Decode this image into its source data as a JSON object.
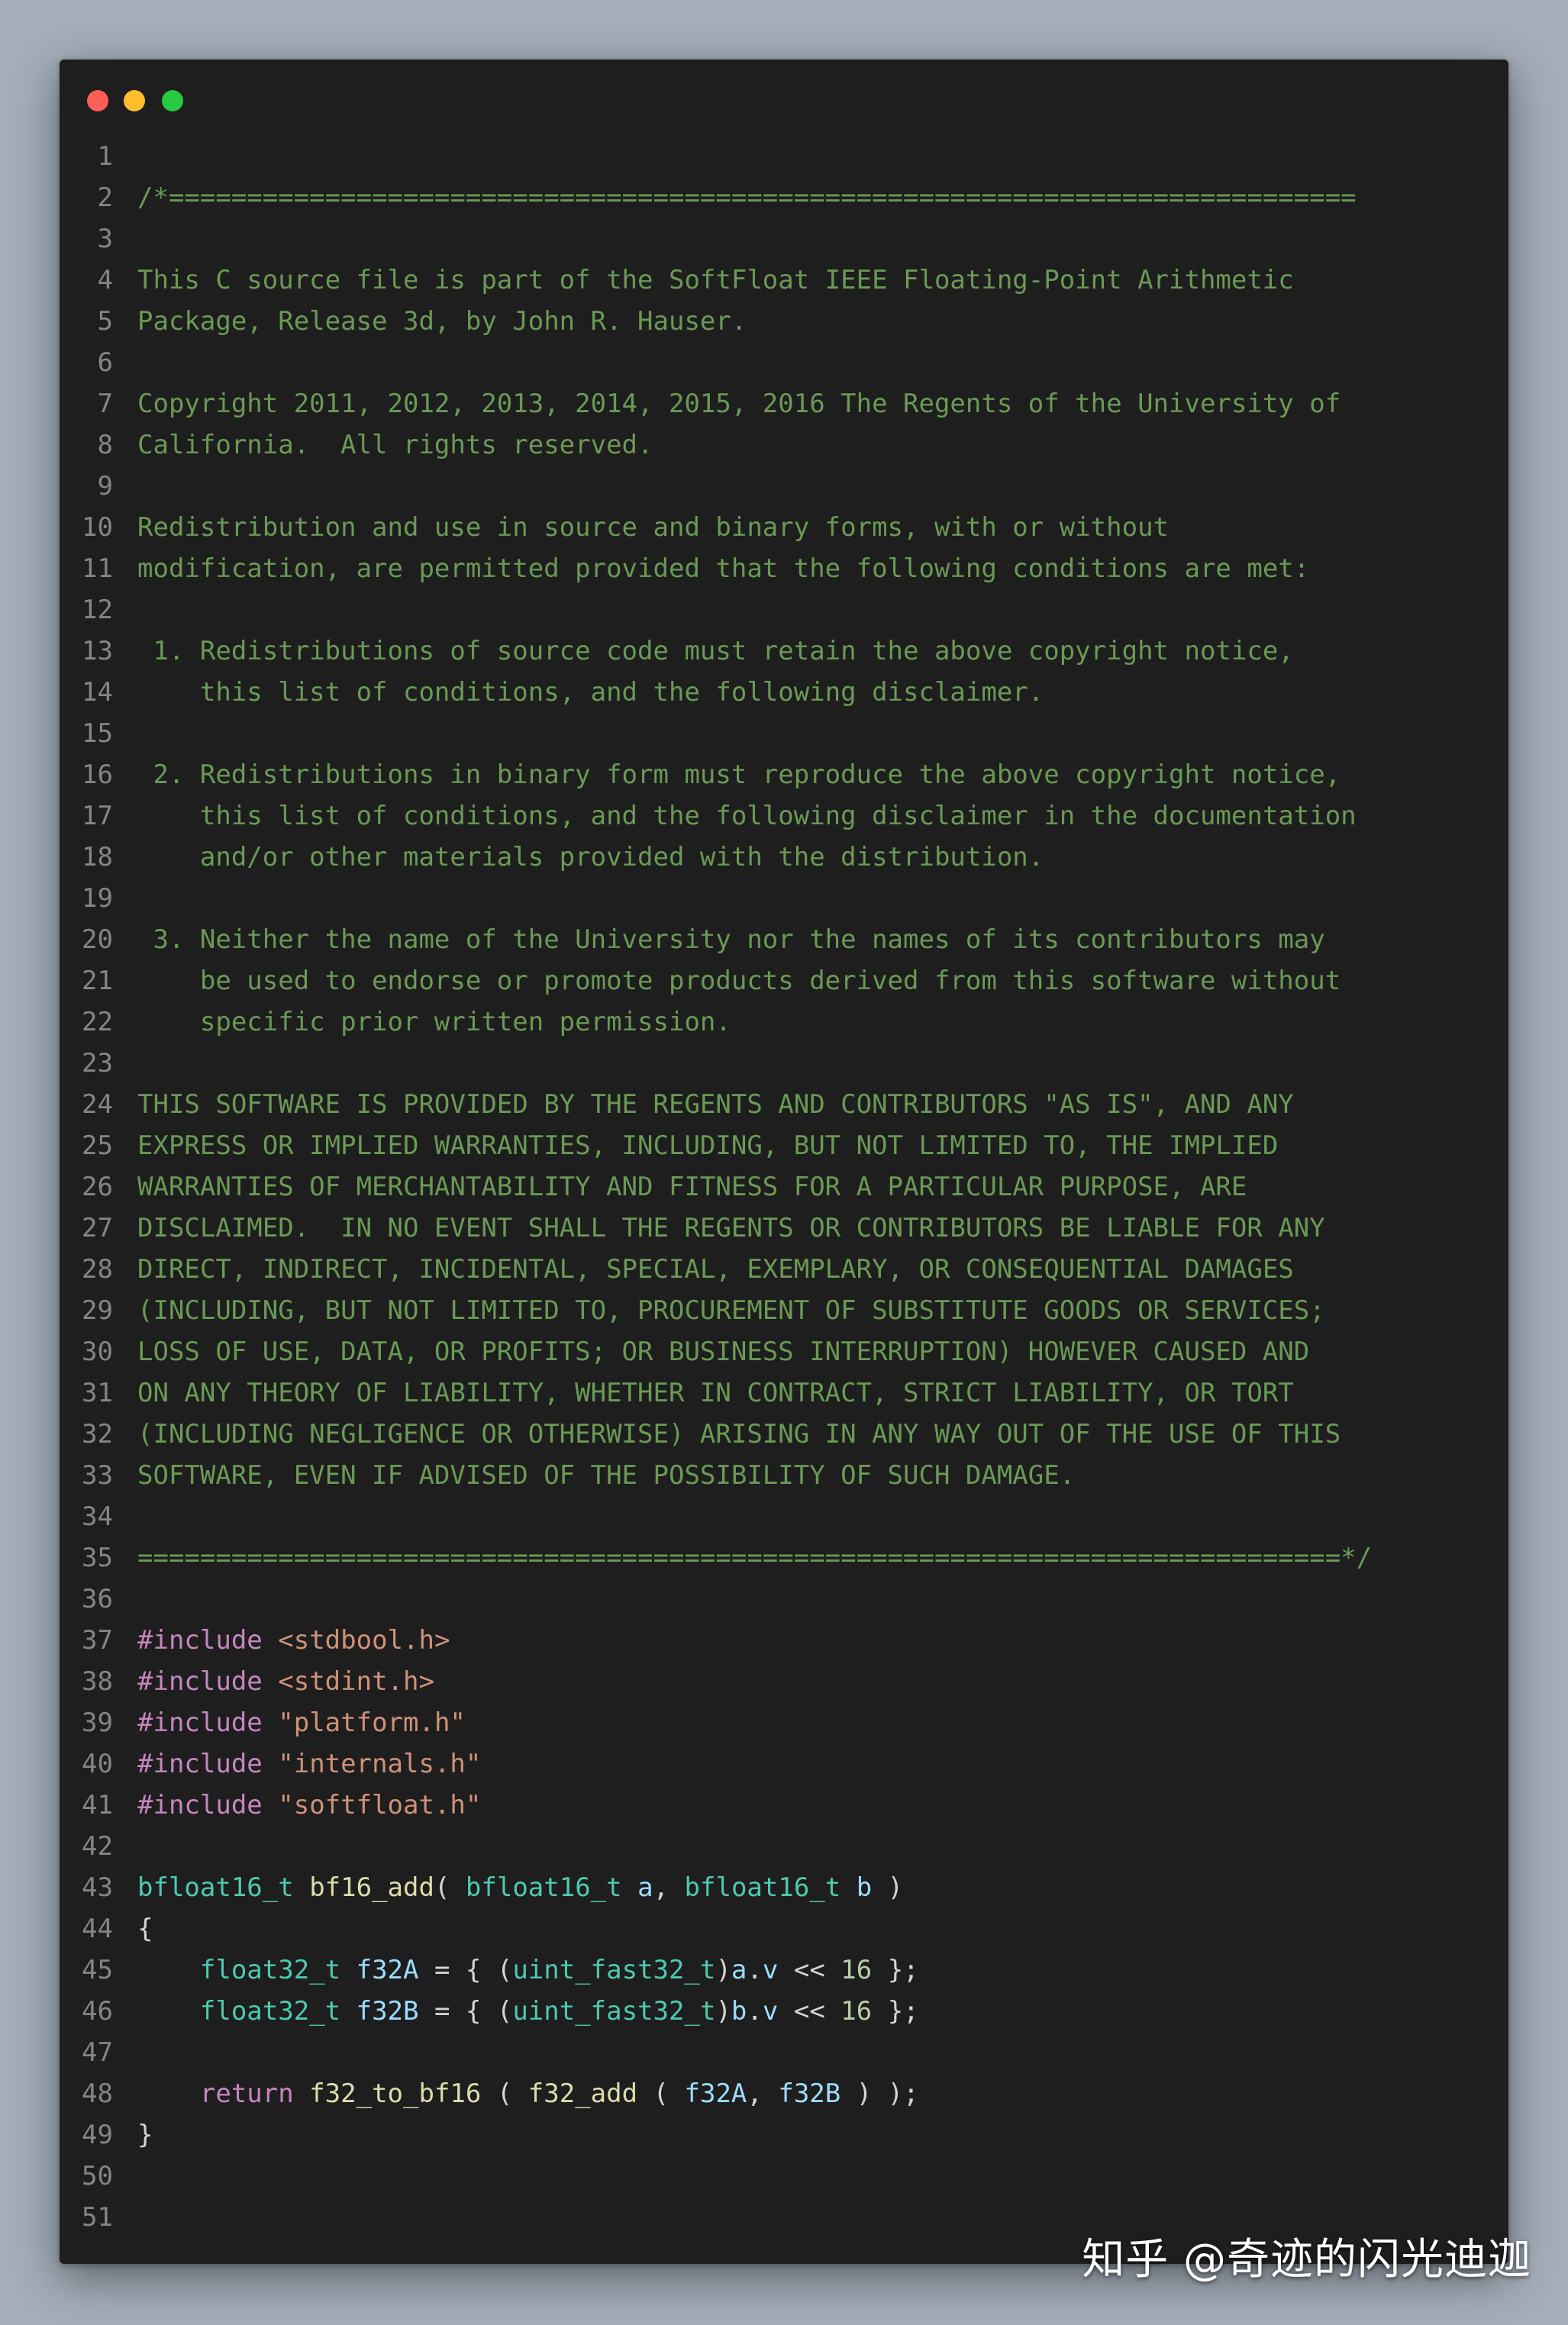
{
  "window": {
    "traffic_lights": [
      "close",
      "minimize",
      "maximize"
    ]
  },
  "editor": {
    "lines": [
      {
        "n": "1",
        "tokens": []
      },
      {
        "n": "2",
        "tokens": [
          {
            "c": "comment",
            "t": "/*============================================================================"
          }
        ]
      },
      {
        "n": "3",
        "tokens": []
      },
      {
        "n": "4",
        "tokens": [
          {
            "c": "comment",
            "t": "This C source file is part of the SoftFloat IEEE Floating-Point Arithmetic"
          }
        ]
      },
      {
        "n": "5",
        "tokens": [
          {
            "c": "comment",
            "t": "Package, Release 3d, by John R. Hauser."
          }
        ]
      },
      {
        "n": "6",
        "tokens": []
      },
      {
        "n": "7",
        "tokens": [
          {
            "c": "comment",
            "t": "Copyright 2011, 2012, 2013, 2014, 2015, 2016 The Regents of the University of"
          }
        ]
      },
      {
        "n": "8",
        "tokens": [
          {
            "c": "comment",
            "t": "California.  All rights reserved."
          }
        ]
      },
      {
        "n": "9",
        "tokens": []
      },
      {
        "n": "10",
        "tokens": [
          {
            "c": "comment",
            "t": "Redistribution and use in source and binary forms, with or without"
          }
        ]
      },
      {
        "n": "11",
        "tokens": [
          {
            "c": "comment",
            "t": "modification, are permitted provided that the following conditions are met:"
          }
        ]
      },
      {
        "n": "12",
        "tokens": []
      },
      {
        "n": "13",
        "tokens": [
          {
            "c": "comment",
            "t": " 1. Redistributions of source code must retain the above copyright notice,"
          }
        ]
      },
      {
        "n": "14",
        "tokens": [
          {
            "c": "comment",
            "t": "    this list of conditions, and the following disclaimer."
          }
        ]
      },
      {
        "n": "15",
        "tokens": []
      },
      {
        "n": "16",
        "tokens": [
          {
            "c": "comment",
            "t": " 2. Redistributions in binary form must reproduce the above copyright notice,"
          }
        ]
      },
      {
        "n": "17",
        "tokens": [
          {
            "c": "comment",
            "t": "    this list of conditions, and the following disclaimer in the documentation"
          }
        ]
      },
      {
        "n": "18",
        "tokens": [
          {
            "c": "comment",
            "t": "    and/or other materials provided with the distribution."
          }
        ]
      },
      {
        "n": "19",
        "tokens": []
      },
      {
        "n": "20",
        "tokens": [
          {
            "c": "comment",
            "t": " 3. Neither the name of the University nor the names of its contributors may"
          }
        ]
      },
      {
        "n": "21",
        "tokens": [
          {
            "c": "comment",
            "t": "    be used to endorse or promote products derived from this software without"
          }
        ]
      },
      {
        "n": "22",
        "tokens": [
          {
            "c": "comment",
            "t": "    specific prior written permission."
          }
        ]
      },
      {
        "n": "23",
        "tokens": []
      },
      {
        "n": "24",
        "tokens": [
          {
            "c": "comment",
            "t": "THIS SOFTWARE IS PROVIDED BY THE REGENTS AND CONTRIBUTORS \"AS IS\", AND ANY"
          }
        ]
      },
      {
        "n": "25",
        "tokens": [
          {
            "c": "comment",
            "t": "EXPRESS OR IMPLIED WARRANTIES, INCLUDING, BUT NOT LIMITED TO, THE IMPLIED"
          }
        ]
      },
      {
        "n": "26",
        "tokens": [
          {
            "c": "comment",
            "t": "WARRANTIES OF MERCHANTABILITY AND FITNESS FOR A PARTICULAR PURPOSE, ARE"
          }
        ]
      },
      {
        "n": "27",
        "tokens": [
          {
            "c": "comment",
            "t": "DISCLAIMED.  IN NO EVENT SHALL THE REGENTS OR CONTRIBUTORS BE LIABLE FOR ANY"
          }
        ]
      },
      {
        "n": "28",
        "tokens": [
          {
            "c": "comment",
            "t": "DIRECT, INDIRECT, INCIDENTAL, SPECIAL, EXEMPLARY, OR CONSEQUENTIAL DAMAGES"
          }
        ]
      },
      {
        "n": "29",
        "tokens": [
          {
            "c": "comment",
            "t": "(INCLUDING, BUT NOT LIMITED TO, PROCUREMENT OF SUBSTITUTE GOODS OR SERVICES;"
          }
        ]
      },
      {
        "n": "30",
        "tokens": [
          {
            "c": "comment",
            "t": "LOSS OF USE, DATA, OR PROFITS; OR BUSINESS INTERRUPTION) HOWEVER CAUSED AND"
          }
        ]
      },
      {
        "n": "31",
        "tokens": [
          {
            "c": "comment",
            "t": "ON ANY THEORY OF LIABILITY, WHETHER IN CONTRACT, STRICT LIABILITY, OR TORT"
          }
        ]
      },
      {
        "n": "32",
        "tokens": [
          {
            "c": "comment",
            "t": "(INCLUDING NEGLIGENCE OR OTHERWISE) ARISING IN ANY WAY OUT OF THE USE OF THIS"
          }
        ]
      },
      {
        "n": "33",
        "tokens": [
          {
            "c": "comment",
            "t": "SOFTWARE, EVEN IF ADVISED OF THE POSSIBILITY OF SUCH DAMAGE."
          }
        ]
      },
      {
        "n": "34",
        "tokens": []
      },
      {
        "n": "35",
        "tokens": [
          {
            "c": "comment",
            "t": "=============================================================================*/"
          }
        ]
      },
      {
        "n": "36",
        "tokens": []
      },
      {
        "n": "37",
        "tokens": [
          {
            "c": "kw",
            "t": "#include"
          },
          {
            "c": "punc",
            "t": " "
          },
          {
            "c": "str",
            "t": "<stdbool.h>"
          }
        ]
      },
      {
        "n": "38",
        "tokens": [
          {
            "c": "kw",
            "t": "#include"
          },
          {
            "c": "punc",
            "t": " "
          },
          {
            "c": "str",
            "t": "<stdint.h>"
          }
        ]
      },
      {
        "n": "39",
        "tokens": [
          {
            "c": "kw",
            "t": "#include"
          },
          {
            "c": "punc",
            "t": " "
          },
          {
            "c": "str",
            "t": "\"platform.h\""
          }
        ]
      },
      {
        "n": "40",
        "tokens": [
          {
            "c": "kw",
            "t": "#include"
          },
          {
            "c": "punc",
            "t": " "
          },
          {
            "c": "str",
            "t": "\"internals.h\""
          }
        ]
      },
      {
        "n": "41",
        "tokens": [
          {
            "c": "kw",
            "t": "#include"
          },
          {
            "c": "punc",
            "t": " "
          },
          {
            "c": "str",
            "t": "\"softfloat.h\""
          }
        ]
      },
      {
        "n": "42",
        "tokens": []
      },
      {
        "n": "43",
        "tokens": [
          {
            "c": "type",
            "t": "bfloat16_t"
          },
          {
            "c": "punc",
            "t": " "
          },
          {
            "c": "fn",
            "t": "bf16_add"
          },
          {
            "c": "punc",
            "t": "( "
          },
          {
            "c": "type",
            "t": "bfloat16_t"
          },
          {
            "c": "punc",
            "t": " "
          },
          {
            "c": "var",
            "t": "a"
          },
          {
            "c": "punc",
            "t": ", "
          },
          {
            "c": "type",
            "t": "bfloat16_t"
          },
          {
            "c": "punc",
            "t": " "
          },
          {
            "c": "var",
            "t": "b"
          },
          {
            "c": "punc",
            "t": " )"
          }
        ]
      },
      {
        "n": "44",
        "tokens": [
          {
            "c": "punc",
            "t": "{"
          }
        ]
      },
      {
        "n": "45",
        "tokens": [
          {
            "c": "punc",
            "t": "    "
          },
          {
            "c": "type",
            "t": "float32_t"
          },
          {
            "c": "punc",
            "t": " "
          },
          {
            "c": "var",
            "t": "f32A"
          },
          {
            "c": "punc",
            "t": " = { ("
          },
          {
            "c": "type",
            "t": "uint_fast32_t"
          },
          {
            "c": "punc",
            "t": ")"
          },
          {
            "c": "var",
            "t": "a"
          },
          {
            "c": "punc",
            "t": "."
          },
          {
            "c": "var",
            "t": "v"
          },
          {
            "c": "punc",
            "t": " << "
          },
          {
            "c": "num",
            "t": "16"
          },
          {
            "c": "punc",
            "t": " };"
          }
        ]
      },
      {
        "n": "46",
        "tokens": [
          {
            "c": "punc",
            "t": "    "
          },
          {
            "c": "type",
            "t": "float32_t"
          },
          {
            "c": "punc",
            "t": " "
          },
          {
            "c": "var",
            "t": "f32B"
          },
          {
            "c": "punc",
            "t": " = { ("
          },
          {
            "c": "type",
            "t": "uint_fast32_t"
          },
          {
            "c": "punc",
            "t": ")"
          },
          {
            "c": "var",
            "t": "b"
          },
          {
            "c": "punc",
            "t": "."
          },
          {
            "c": "var",
            "t": "v"
          },
          {
            "c": "punc",
            "t": " << "
          },
          {
            "c": "num",
            "t": "16"
          },
          {
            "c": "punc",
            "t": " };"
          }
        ]
      },
      {
        "n": "47",
        "tokens": []
      },
      {
        "n": "48",
        "tokens": [
          {
            "c": "punc",
            "t": "    "
          },
          {
            "c": "ctl",
            "t": "return"
          },
          {
            "c": "punc",
            "t": " "
          },
          {
            "c": "fn",
            "t": "f32_to_bf16"
          },
          {
            "c": "punc",
            "t": " ( "
          },
          {
            "c": "fn",
            "t": "f32_add"
          },
          {
            "c": "punc",
            "t": " ( "
          },
          {
            "c": "var",
            "t": "f32A"
          },
          {
            "c": "punc",
            "t": ", "
          },
          {
            "c": "var",
            "t": "f32B"
          },
          {
            "c": "punc",
            "t": " ) );"
          }
        ]
      },
      {
        "n": "49",
        "tokens": [
          {
            "c": "punc",
            "t": "}"
          }
        ]
      },
      {
        "n": "50",
        "tokens": []
      },
      {
        "n": "51",
        "tokens": []
      }
    ]
  },
  "watermark": {
    "text": "知乎 @奇迹的闪光迪迦"
  },
  "colors": {
    "background": "#a4aeb9",
    "editor_bg": "#1e1e1e",
    "comment": "#6a9955",
    "keyword": "#c586c0",
    "string": "#ce9178",
    "type": "#4ec9b0",
    "function": "#dcdcaa",
    "variable": "#9cdcfe",
    "number": "#b5cea8",
    "line_number": "#858585"
  }
}
